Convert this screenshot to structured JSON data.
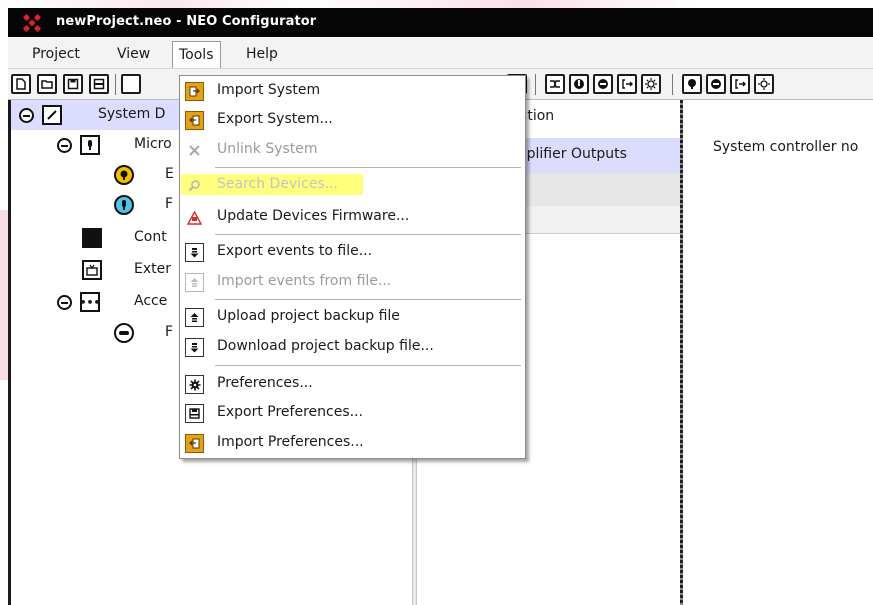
{
  "window": {
    "title": "newProject.neo - NEO Configurator"
  },
  "menubar": {
    "items": [
      {
        "label": "Project"
      },
      {
        "label": "View"
      },
      {
        "label": "Tools"
      },
      {
        "label": "Help"
      }
    ]
  },
  "tree": {
    "items": [
      {
        "label": "System D",
        "icon": "pen-icon"
      },
      {
        "label": "Micro",
        "icon": "microphone-icon"
      },
      {
        "label": "E",
        "icon": "paging-station-icon"
      },
      {
        "label": "F",
        "icon": "microphone-round-icon"
      },
      {
        "label": "Cont",
        "icon": "display-icon"
      },
      {
        "label": "Exter",
        "icon": "external-device-icon"
      },
      {
        "label": "Acce",
        "icon": "more-dots-icon"
      },
      {
        "label": "F",
        "icon": "button-icon"
      }
    ]
  },
  "middle_panel": {
    "rows": [
      {
        "label": "ration"
      },
      {
        "label": "mplifier Outputs"
      },
      {
        "label": ""
      },
      {
        "label": ""
      }
    ]
  },
  "right_panel": {
    "message": "System controller no"
  },
  "tools_menu": {
    "items": [
      {
        "label": "Import System",
        "icon": "import-system-icon",
        "enabled": true
      },
      {
        "label": "Export System...",
        "icon": "export-system-icon",
        "enabled": true
      },
      {
        "label": "Unlink System",
        "icon": "unlink-icon",
        "enabled": false
      },
      {
        "label": "Search Devices...",
        "icon": "search-icon",
        "enabled": false
      },
      {
        "label": "Update Devices Firmware...",
        "icon": "firmware-warning-icon",
        "enabled": true
      },
      {
        "label": "Export events to file...",
        "icon": "export-events-icon",
        "enabled": true
      },
      {
        "label": "Import events from file...",
        "icon": "import-events-icon",
        "enabled": false
      },
      {
        "label": "Upload project backup file",
        "icon": "upload-icon",
        "enabled": true
      },
      {
        "label": "Download project backup file...",
        "icon": "download-icon",
        "enabled": true
      },
      {
        "label": "Preferences...",
        "icon": "gear-icon",
        "enabled": true
      },
      {
        "label": "Export Preferences...",
        "icon": "save-icon",
        "enabled": true
      },
      {
        "label": "Import Preferences...",
        "icon": "import-preferences-icon",
        "enabled": true
      }
    ],
    "highlight_color": "#ffff66"
  },
  "colors": {
    "titlebar": "#050505",
    "selection": "#dcdcff",
    "logo": "#e0202a"
  }
}
